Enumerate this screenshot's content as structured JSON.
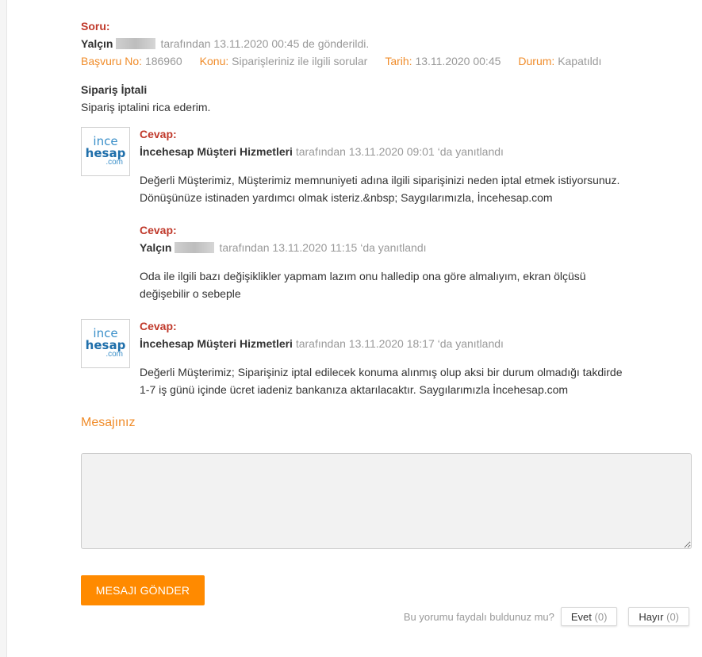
{
  "question": {
    "label": "Soru:",
    "author": "Yalçın",
    "sent_text": "tarafından 13.11.2020 00:45 de gönderildi.",
    "meta": {
      "app_no_label": "Başvuru No:",
      "app_no_value": "186960",
      "topic_label": "Konu:",
      "topic_value": "Siparişleriniz ile ilgili sorular",
      "date_label": "Tarih:",
      "date_value": "13.11.2020 00:45",
      "status_label": "Durum:",
      "status_value": "Kapatıldı"
    },
    "title": "Sipariş İptali",
    "body": "Sipariş iptalini rica ederim."
  },
  "logo": {
    "line1": "ince",
    "line2": "hesap",
    "line3": ".com"
  },
  "replies": [
    {
      "label": "Cevap:",
      "author": "İncehesap Müşteri Hizmetleri",
      "time_text": "tarafından 13.11.2020 09:01 ‘da yanıtlandı",
      "body_line1": "Değerli Müşterimiz, Müşterimiz memnuniyeti adına ilgili siparişinizi neden iptal etmek istiyorsunuz.",
      "body_line2": "Dönüşünüze istinaden yardımcı olmak isteriz.&nbsp; Saygılarımızla, İncehesap.com"
    },
    {
      "label": "Cevap:",
      "author": "Yalçın",
      "time_text": "tarafından 13.11.2020 11:15 ‘da yanıtlandı",
      "body_line1": "Oda ile ilgili bazı değişiklikler yapmam lazım onu halledip ona göre almalıyım, ekran ölçüsü",
      "body_line2": "değişebilir o sebeple"
    },
    {
      "label": "Cevap:",
      "author": "İncehesap Müşteri Hizmetleri",
      "time_text": "tarafından 13.11.2020 18:17 ‘da yanıtlandı",
      "body_line1": "Değerli Müşterimiz; Siparişiniz iptal edilecek konuma alınmış olup aksi bir durum olmadığı takdirde",
      "body_line2": "1-7 iş günü içinde ücret iadeniz bankanıza aktarılacaktır. Saygılarımızla İncehesap.com"
    }
  ],
  "message_section": {
    "title": "Mesajınız",
    "send_label": "MESAJI GÖNDER"
  },
  "feedback": {
    "question": "Bu yorumu faydalı buldunuz mu?",
    "yes_label": "Evet",
    "yes_count": "(0)",
    "no_label": "Hayır",
    "no_count": "(0)"
  },
  "colors": {
    "accent": "#ff8a00",
    "label_red": "#c0392b",
    "meta_orange": "#f08c2a",
    "muted": "#999999"
  }
}
